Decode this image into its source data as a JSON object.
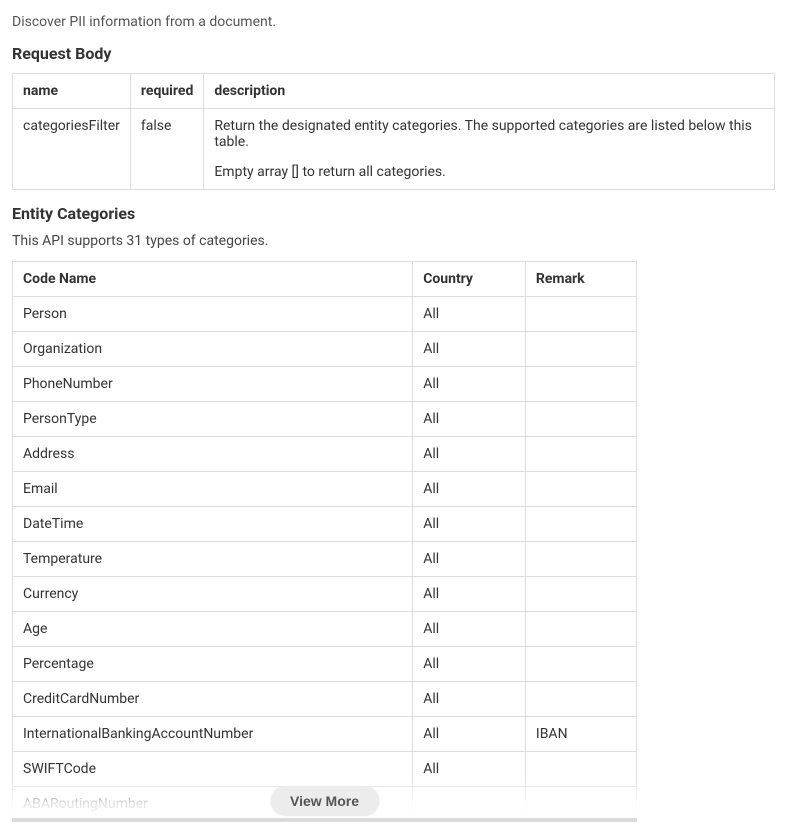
{
  "intro": "Discover PII information from a document.",
  "request_body": {
    "heading": "Request Body",
    "headers": {
      "name": "name",
      "required": "required",
      "description": "description"
    },
    "rows": [
      {
        "name": "categoriesFilter",
        "required": "false",
        "description_line1": "Return the designated entity categories. The supported categories are listed below this table.",
        "description_line2": "Empty array [] to return all categories."
      }
    ]
  },
  "entity_categories": {
    "heading": "Entity Categories",
    "subtext": "This API supports 31 types of categories.",
    "headers": {
      "code_name": "Code Name",
      "country": "Country",
      "remark": "Remark"
    },
    "rows": [
      {
        "code_name": "Person",
        "country": "All",
        "remark": ""
      },
      {
        "code_name": "Organization",
        "country": "All",
        "remark": ""
      },
      {
        "code_name": "PhoneNumber",
        "country": "All",
        "remark": ""
      },
      {
        "code_name": "PersonType",
        "country": "All",
        "remark": ""
      },
      {
        "code_name": "Address",
        "country": "All",
        "remark": ""
      },
      {
        "code_name": "Email",
        "country": "All",
        "remark": ""
      },
      {
        "code_name": "DateTime",
        "country": "All",
        "remark": ""
      },
      {
        "code_name": "Temperature",
        "country": "All",
        "remark": ""
      },
      {
        "code_name": "Currency",
        "country": "All",
        "remark": ""
      },
      {
        "code_name": "Age",
        "country": "All",
        "remark": ""
      },
      {
        "code_name": "Percentage",
        "country": "All",
        "remark": ""
      },
      {
        "code_name": "CreditCardNumber",
        "country": "All",
        "remark": ""
      },
      {
        "code_name": "InternationalBankingAccountNumber",
        "country": "All",
        "remark": "IBAN"
      },
      {
        "code_name": "SWIFTCode",
        "country": "All",
        "remark": ""
      },
      {
        "code_name": "ABARoutingNumber",
        "country": "",
        "remark": ""
      }
    ],
    "view_more_label": "View More"
  }
}
